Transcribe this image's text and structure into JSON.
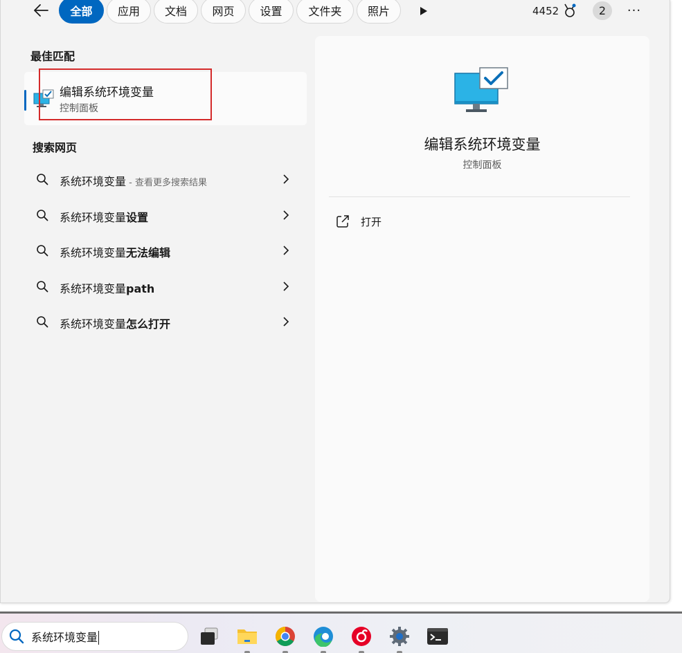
{
  "filters": {
    "back_label": "←",
    "tabs": [
      {
        "label": "全部",
        "active": true
      },
      {
        "label": "应用",
        "active": false
      },
      {
        "label": "文档",
        "active": false
      },
      {
        "label": "网页",
        "active": false
      },
      {
        "label": "设置",
        "active": false
      },
      {
        "label": "文件夹",
        "active": false
      },
      {
        "label": "照片",
        "active": false
      }
    ],
    "points": "4452",
    "points_icon": "rewards-medal-icon",
    "account_badge": "2",
    "more_label": "···"
  },
  "best_match": {
    "section_title": "最佳匹配",
    "title": "编辑系统环境变量",
    "subtitle": "控制面板",
    "icon": "monitor-check-icon"
  },
  "web_search": {
    "section_title": "搜索网页",
    "items": [
      {
        "prefix": "系统环境变量",
        "bold": "",
        "hint": " - 查看更多搜索结果"
      },
      {
        "prefix": "系统环境变量",
        "bold": "设置",
        "hint": ""
      },
      {
        "prefix": "系统环境变量",
        "bold": "无法编辑",
        "hint": ""
      },
      {
        "prefix": "系统环境变量",
        "bold": "path",
        "hint": ""
      },
      {
        "prefix": "系统环境变量",
        "bold": "怎么打开",
        "hint": ""
      }
    ]
  },
  "preview": {
    "title": "编辑系统环境变量",
    "subtitle": "控制面板",
    "open_label": "打开"
  },
  "taskbar": {
    "search_value": "系统环境变量",
    "apps": [
      {
        "name": "task-view-icon"
      },
      {
        "name": "file-explorer-icon"
      },
      {
        "name": "chrome-icon"
      },
      {
        "name": "edge-icon"
      },
      {
        "name": "netease-music-icon"
      },
      {
        "name": "settings-gear-icon"
      },
      {
        "name": "terminal-icon"
      }
    ]
  },
  "colors": {
    "accent": "#0067c0",
    "highlight_box": "#d42a2a"
  }
}
